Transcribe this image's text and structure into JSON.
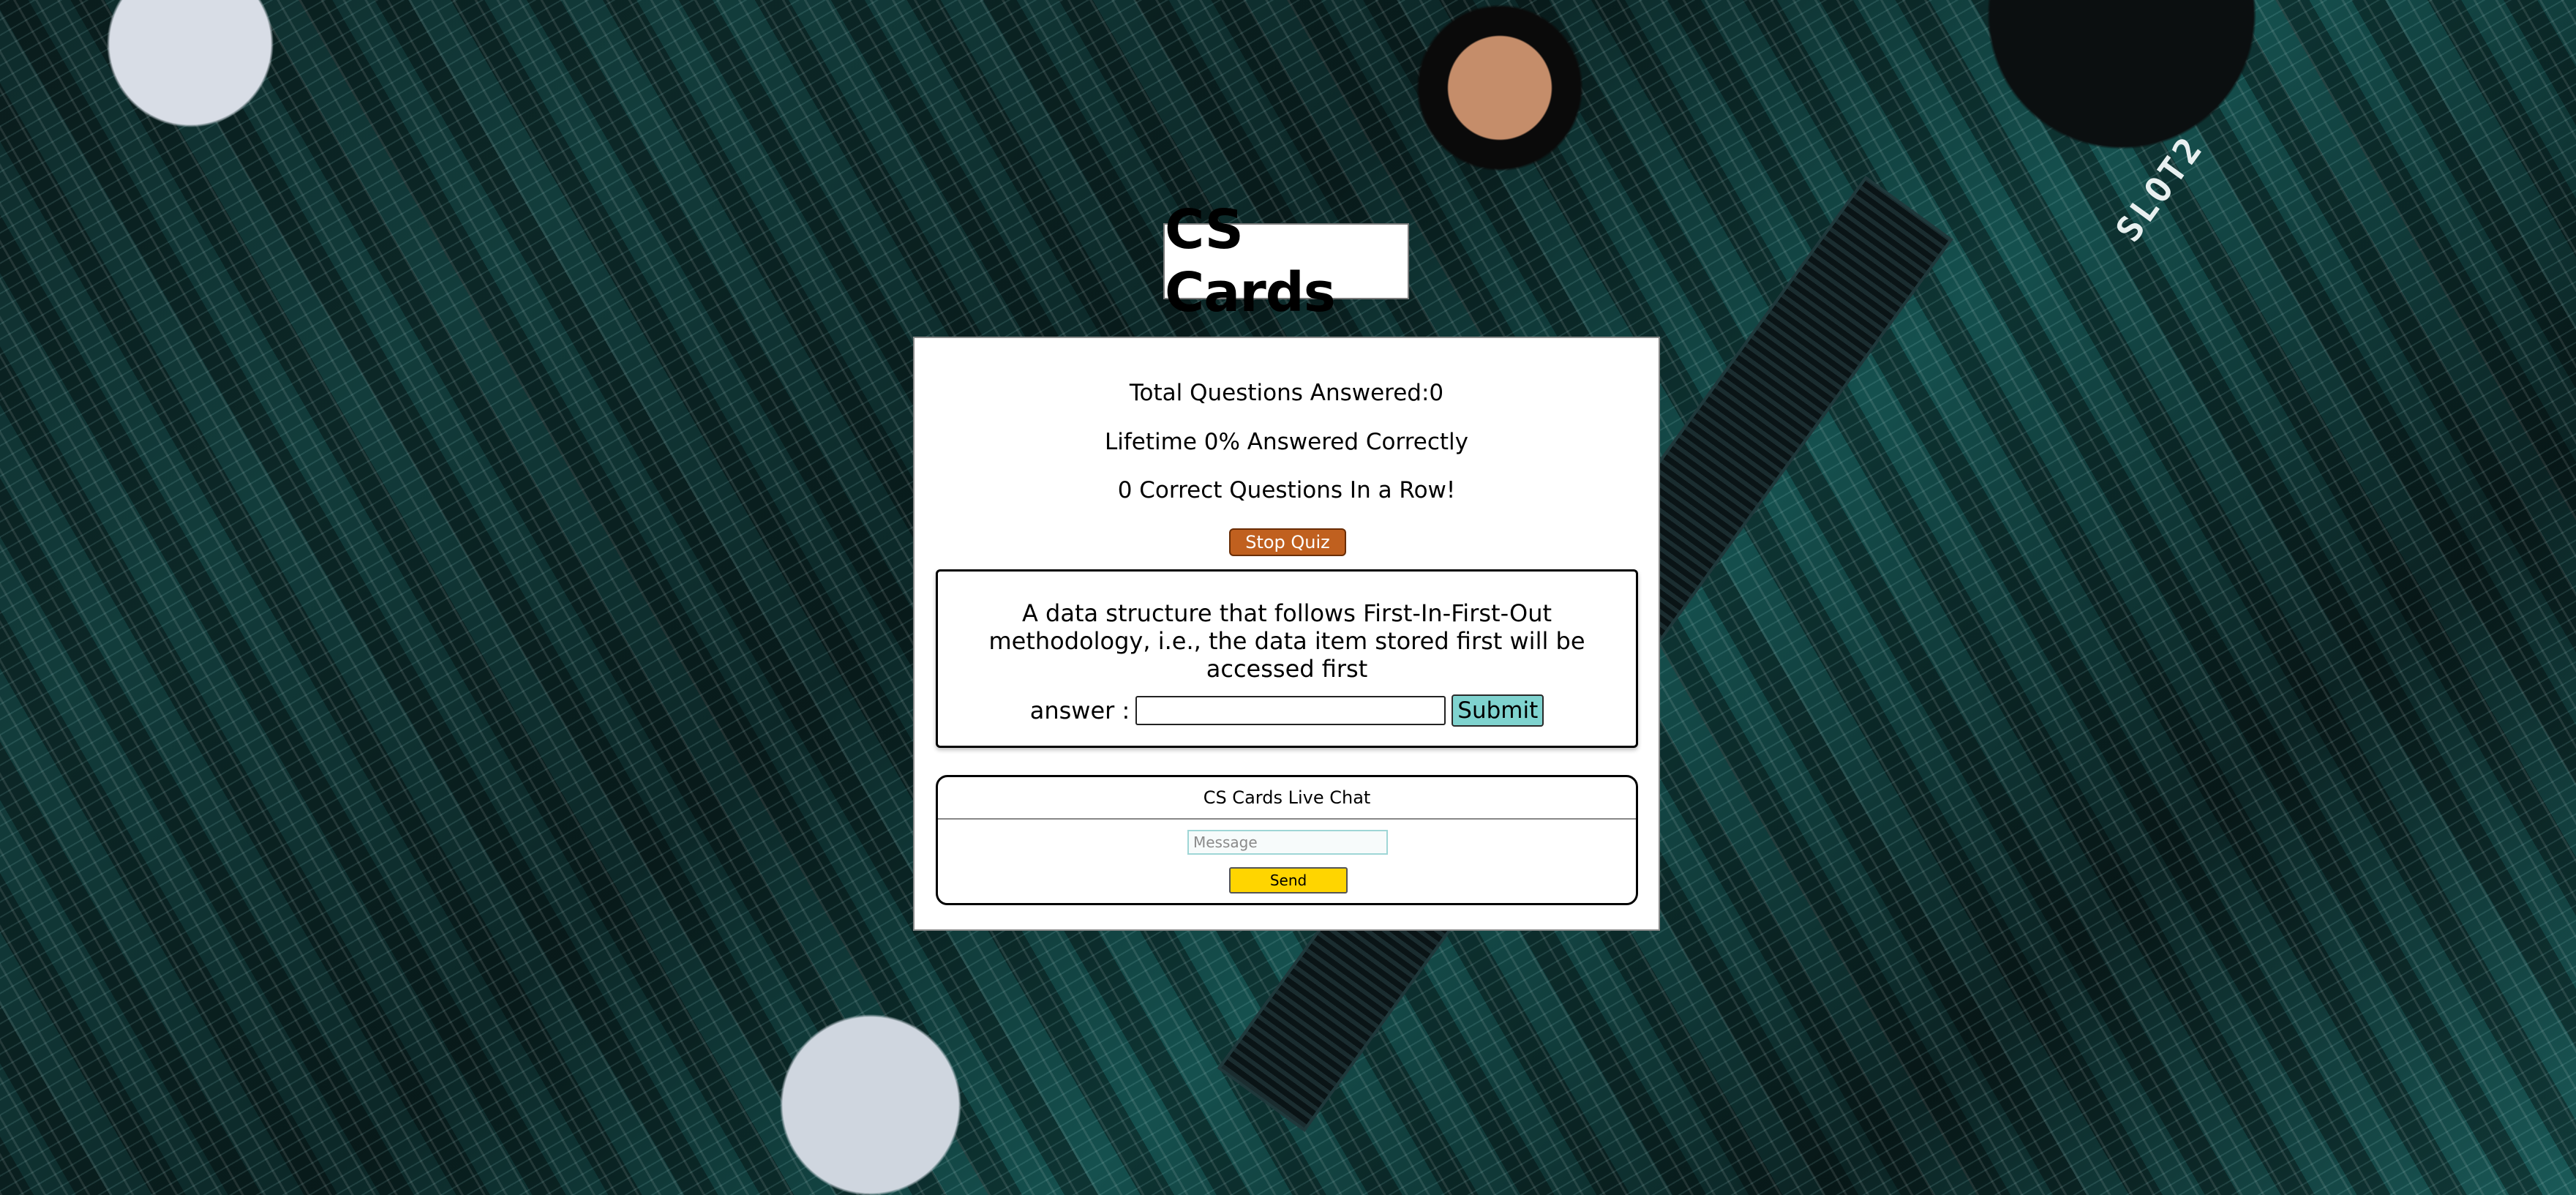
{
  "app": {
    "title": "CS Cards"
  },
  "stats": {
    "total_answered": "Total Questions Answered:0",
    "lifetime_pct": "Lifetime 0% Answered Correctly",
    "streak": "0 Correct Questions In a Row!"
  },
  "quiz": {
    "stop_label": "Stop Quiz",
    "question": "A data structure that follows First-In-First-Out methodology, i.e., the data item stored first will be accessed first",
    "answer_label": "answer :",
    "answer_value": "",
    "submit_label": "Submit"
  },
  "chat": {
    "title": "CS Cards Live Chat",
    "placeholder": "Message",
    "send_label": "Send"
  },
  "background": {
    "slot_label": "SLOT2"
  },
  "colors": {
    "stop_button": "#c0601f",
    "submit_button": "#7fd3cf",
    "send_button": "#ffd500",
    "panel": "#ffffff"
  }
}
